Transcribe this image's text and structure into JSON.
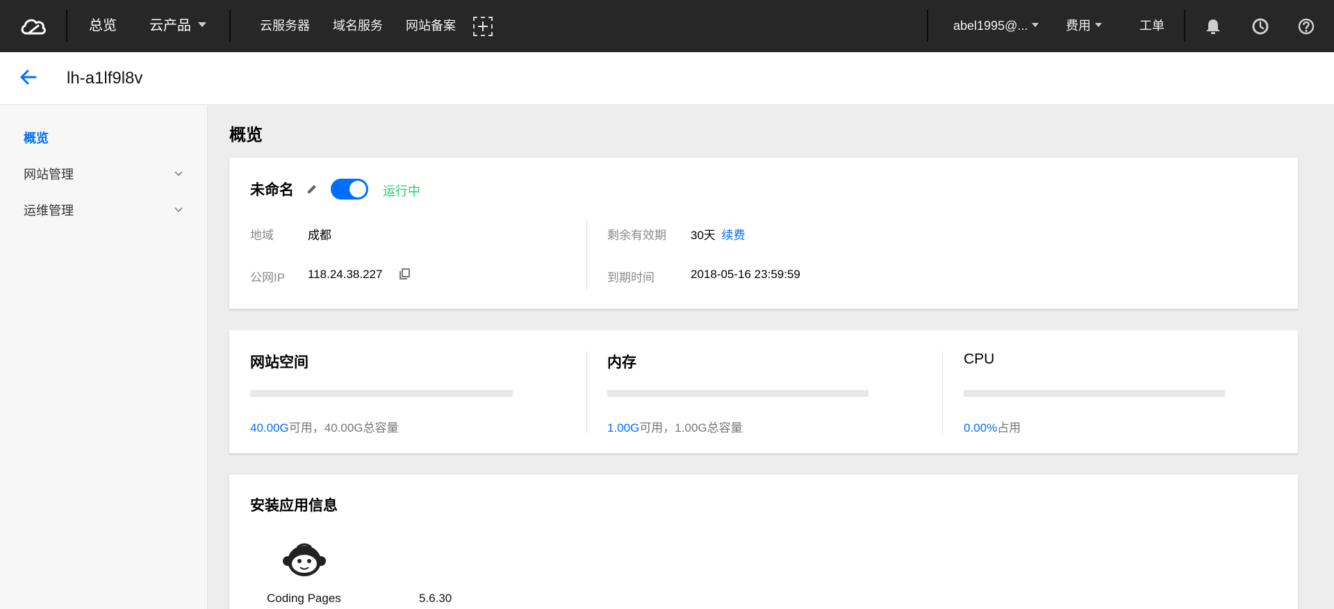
{
  "topbar": {
    "nav": {
      "overview": "总览",
      "products": "云产品",
      "cvm": "云服务器",
      "domain": "域名服务",
      "icp": "网站备案"
    },
    "account": "abel1995@...",
    "billing": "费用",
    "ticket": "工单",
    "icons": [
      "cloud-logo-icon",
      "add-shortcut-icon",
      "bell-icon",
      "clock-icon",
      "help-icon"
    ]
  },
  "header": {
    "title": "lh-a1lf9l8v"
  },
  "sidebar": {
    "items": [
      {
        "label": "概览",
        "active": true
      },
      {
        "label": "网站管理",
        "expandable": true
      },
      {
        "label": "运维管理",
        "expandable": true
      }
    ]
  },
  "main": {
    "title": "概览",
    "instance": {
      "name": "未命名",
      "status": "运行中",
      "running": true,
      "region_label": "地域",
      "region": "成都",
      "ip_label": "公网IP",
      "ip": "118.24.38.227",
      "remaining_label": "剩余有效期",
      "remaining": "30天",
      "renew": "续费",
      "expire_label": "到期时间",
      "expire": "2018-05-16 23:59:59"
    },
    "metrics": [
      {
        "title": "网站空间",
        "highlight": "40.00G",
        "rest": "可用，40.00G总容量",
        "usage_percent": 0
      },
      {
        "title": "内存",
        "highlight": "1.00G",
        "rest": "可用，1.00G总容量",
        "usage_percent": 0
      },
      {
        "title": "CPU",
        "highlight": "0.00%",
        "rest": "占用",
        "usage_percent": 0
      }
    ],
    "apps": {
      "title": "安装应用信息",
      "items": [
        {
          "name": "Coding Pages",
          "version": "5.6.30"
        }
      ]
    }
  },
  "colors": {
    "topbar": "#272727",
    "accent": "#006eff",
    "running": "#29cc6a",
    "page_bg": "#ededed"
  }
}
